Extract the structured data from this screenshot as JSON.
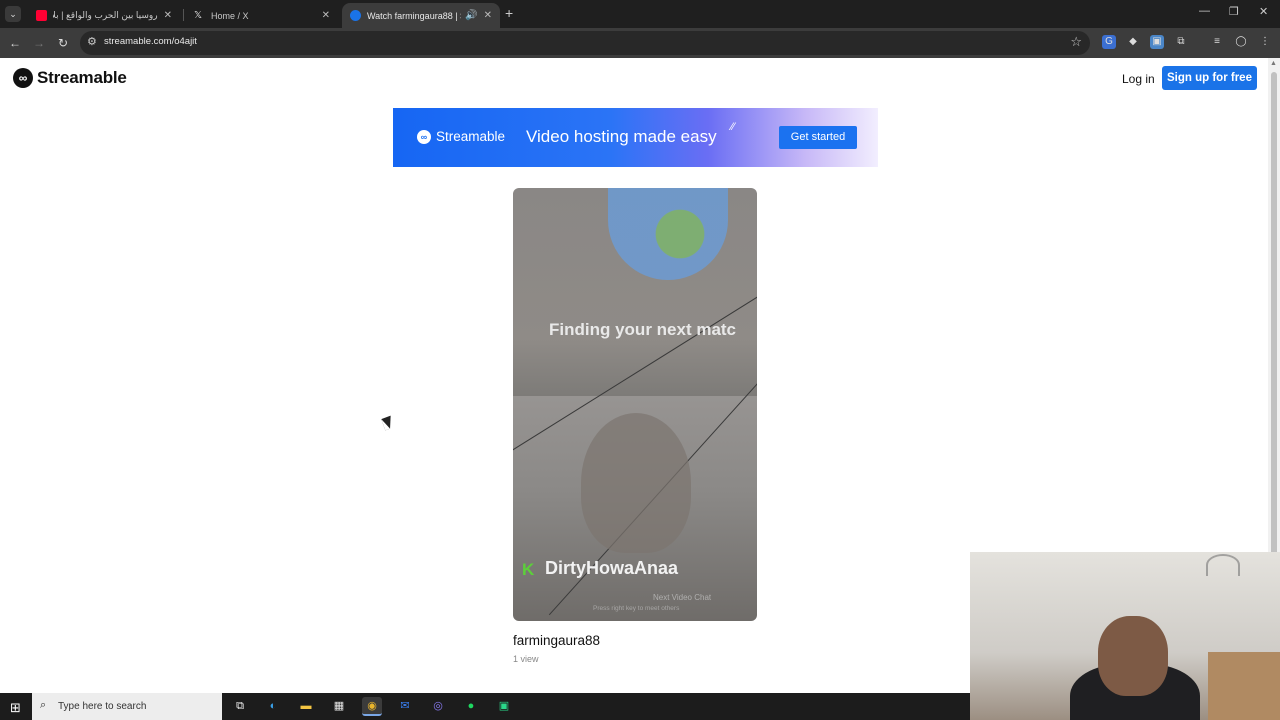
{
  "browser": {
    "tabs": [
      {
        "title": "روسيا بين الحرب والواقع | بلاد",
        "favicon": "youtube-icon",
        "active": false
      },
      {
        "title": "Home / X",
        "favicon": "x-icon",
        "active": false
      },
      {
        "title": "Watch farmingaura88 | Stre",
        "favicon": "streamable-icon",
        "active": true
      }
    ],
    "url": "streamable.com/o4ajit"
  },
  "site": {
    "logo_text": "Streamable",
    "login_label": "Log in",
    "signup_label": "Sign up for free"
  },
  "banner": {
    "brand": "Streamable",
    "tagline": "Video hosting made easy",
    "cta_label": "Get started"
  },
  "video": {
    "overlay_caption": "Finding your next matc",
    "overlay_username": "DirtyHowaAnaa",
    "overlay_next": "Next Video Chat",
    "overlay_sub": "Press right key to meet others"
  },
  "meta": {
    "uploader": "farmingaura88",
    "views": "1 view"
  },
  "taskbar": {
    "search_placeholder": "Type here to search"
  },
  "colors": {
    "brand_blue": "#1a73e8",
    "chrome_dark": "#3c3c3c"
  }
}
